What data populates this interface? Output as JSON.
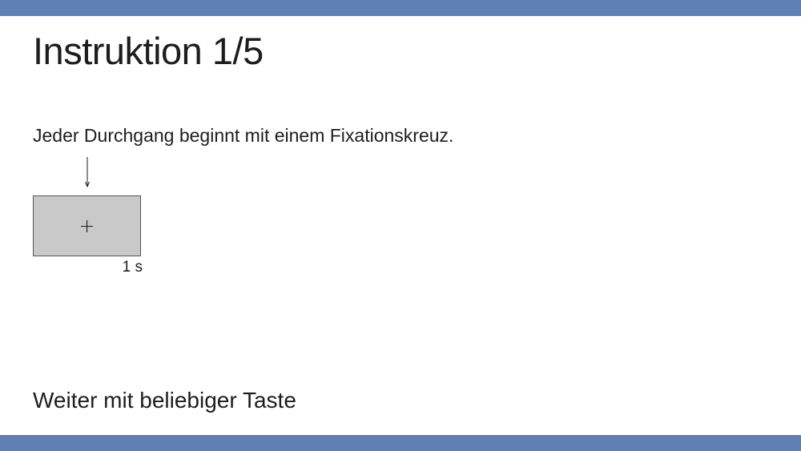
{
  "header": {
    "title": "Instruktion 1/5"
  },
  "main": {
    "instruction_text": "Jeder Durchgang beginnt mit einem Fixationskreuz.",
    "stimulus": {
      "fixation_symbol": "+",
      "duration_label": "1 s",
      "box_color": "#c9c9c9"
    },
    "arrow_icon": "down-arrow-icon"
  },
  "footer": {
    "continue_text": "Weiter mit beliebiger Taste"
  },
  "colors": {
    "bar": "#5f80b5",
    "background": "#ffffff",
    "text": "#1d1d1d"
  }
}
